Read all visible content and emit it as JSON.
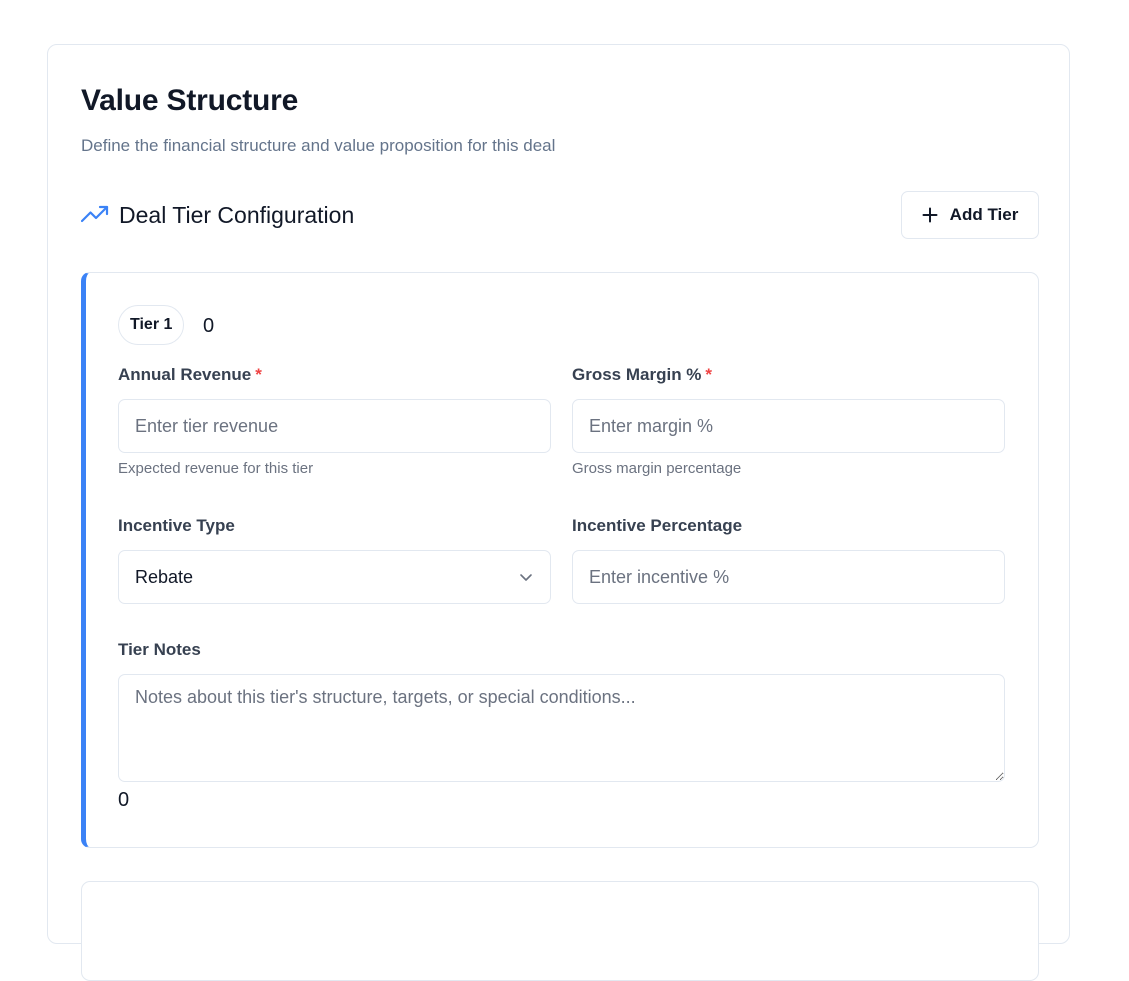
{
  "page": {
    "title": "Value Structure",
    "subtitle": "Define the financial structure and value proposition for this deal"
  },
  "section": {
    "title": "Deal Tier Configuration",
    "icon": "trending-up-icon",
    "add_button_label": "Add Tier"
  },
  "tier": {
    "badge": "Tier 1",
    "header_value": "0",
    "annual_revenue": {
      "label": "Annual Revenue",
      "required": "*",
      "placeholder": "Enter tier revenue",
      "value": "",
      "help": "Expected revenue for this tier"
    },
    "gross_margin": {
      "label": "Gross Margin %",
      "required": "*",
      "placeholder": "Enter margin %",
      "value": "",
      "help": "Gross margin percentage"
    },
    "incentive_type": {
      "label": "Incentive Type",
      "selected": "Rebate"
    },
    "incentive_percentage": {
      "label": "Incentive Percentage",
      "placeholder": "Enter incentive %",
      "value": ""
    },
    "notes": {
      "label": "Tier Notes",
      "placeholder": "Notes about this tier's structure, targets, or special conditions...",
      "value": "",
      "footer_value": "0"
    }
  },
  "colors": {
    "accent": "#3b82f6",
    "required": "#ef4444",
    "border": "#e2e8f0",
    "muted_text": "#64748b"
  }
}
